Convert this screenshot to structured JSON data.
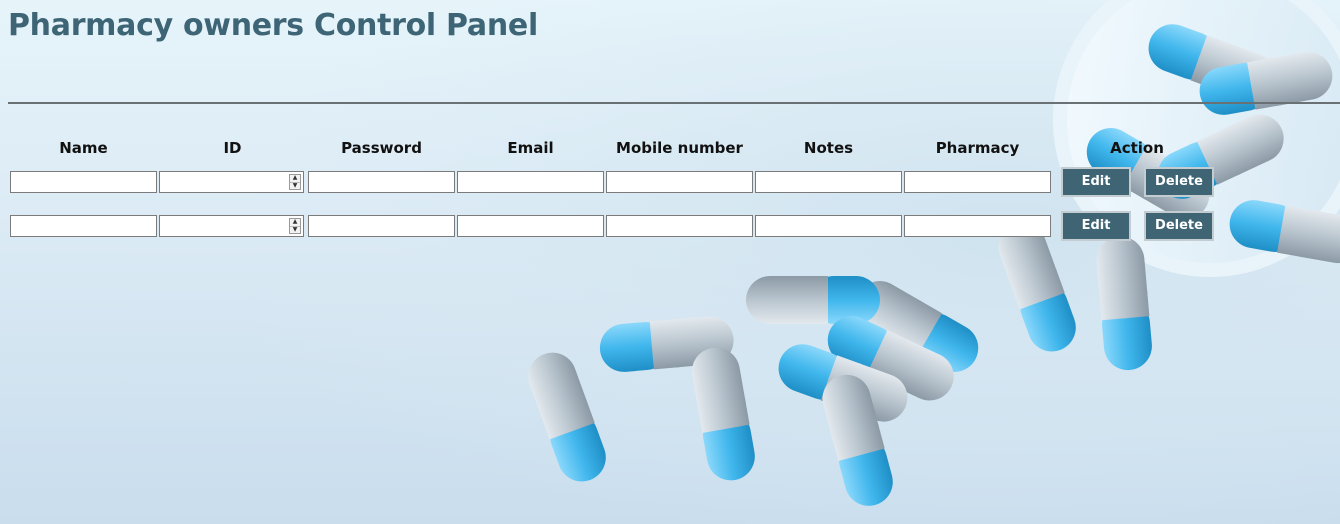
{
  "page": {
    "title": "Pharmacy owners Control Panel"
  },
  "table": {
    "headers": [
      "Name",
      "ID",
      "Password",
      "Email",
      "Mobile number",
      "Notes",
      "Pharmacy",
      "Action"
    ],
    "rows": [
      {
        "name": "",
        "id": "",
        "password": "",
        "email": "",
        "mobile": "",
        "notes": "",
        "pharmacy": "",
        "edit_label": "Edit",
        "delete_label": "Delete"
      },
      {
        "name": "",
        "id": "",
        "password": "",
        "email": "",
        "mobile": "",
        "notes": "",
        "pharmacy": "",
        "edit_label": "Edit",
        "delete_label": "Delete"
      }
    ]
  },
  "colors": {
    "title": "#3e6576",
    "button_bg": "#3f6474",
    "capsule_blue": "#45b9ec",
    "capsule_grey": "#b7c3cd"
  }
}
